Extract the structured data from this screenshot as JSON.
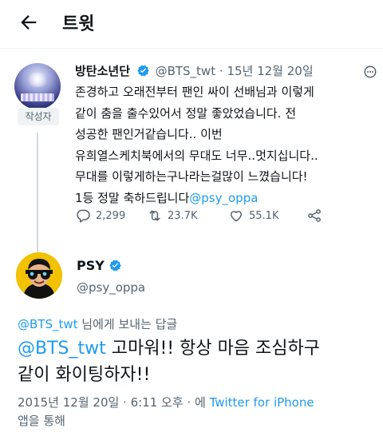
{
  "header": {
    "title": "트윗",
    "back_icon": "arrow-left-icon"
  },
  "parent_tweet": {
    "author_name": "방탄소년단",
    "author_handle": "@BTS_twt",
    "separator": "·",
    "date": "15년 12월 20일",
    "author_badge": "작성자",
    "body_lines": [
      "존경하고 오래전부터 팬인 싸이 선배님과 이렇게",
      "같이 춤을 출수있어서 정말 좋았었습니다. 전",
      "성공한 팬인거같습니다.. 이번",
      "유희열스케치북에서의 무대도 너무..멋지십니다..",
      "무대를 이렇게하는구나라는걸많이 느꼈습니다!"
    ],
    "body_last_text": "1등 정말 축하드립니다",
    "body_mention": "@psy_oppa",
    "replies": "2,299",
    "retweets": "23.7K",
    "likes": "55.1K"
  },
  "reply_tweet": {
    "author_name": "PSY",
    "author_handle": "@psy_oppa",
    "reply_to_handle": "@BTS_twt",
    "reply_to_suffix": " 님에게 보내는 답글",
    "text_mention": "@BTS_twt",
    "text_line1_rest": " 고마워!! 항상 마음 조심하구",
    "text_line2": "같이 화이팅하자!!",
    "timestamp": "2015년 12월 20일 · 6:11 오후 · 에 ",
    "source": "Twitter for iPhone",
    "source_suffix": "앱을 통해"
  },
  "colors": {
    "accent": "#1d9bf0",
    "text_primary": "#0f1419",
    "text_secondary": "#536471",
    "badge_bg": "#eff3f4",
    "psy_avatar_bg": "#f2c100"
  }
}
